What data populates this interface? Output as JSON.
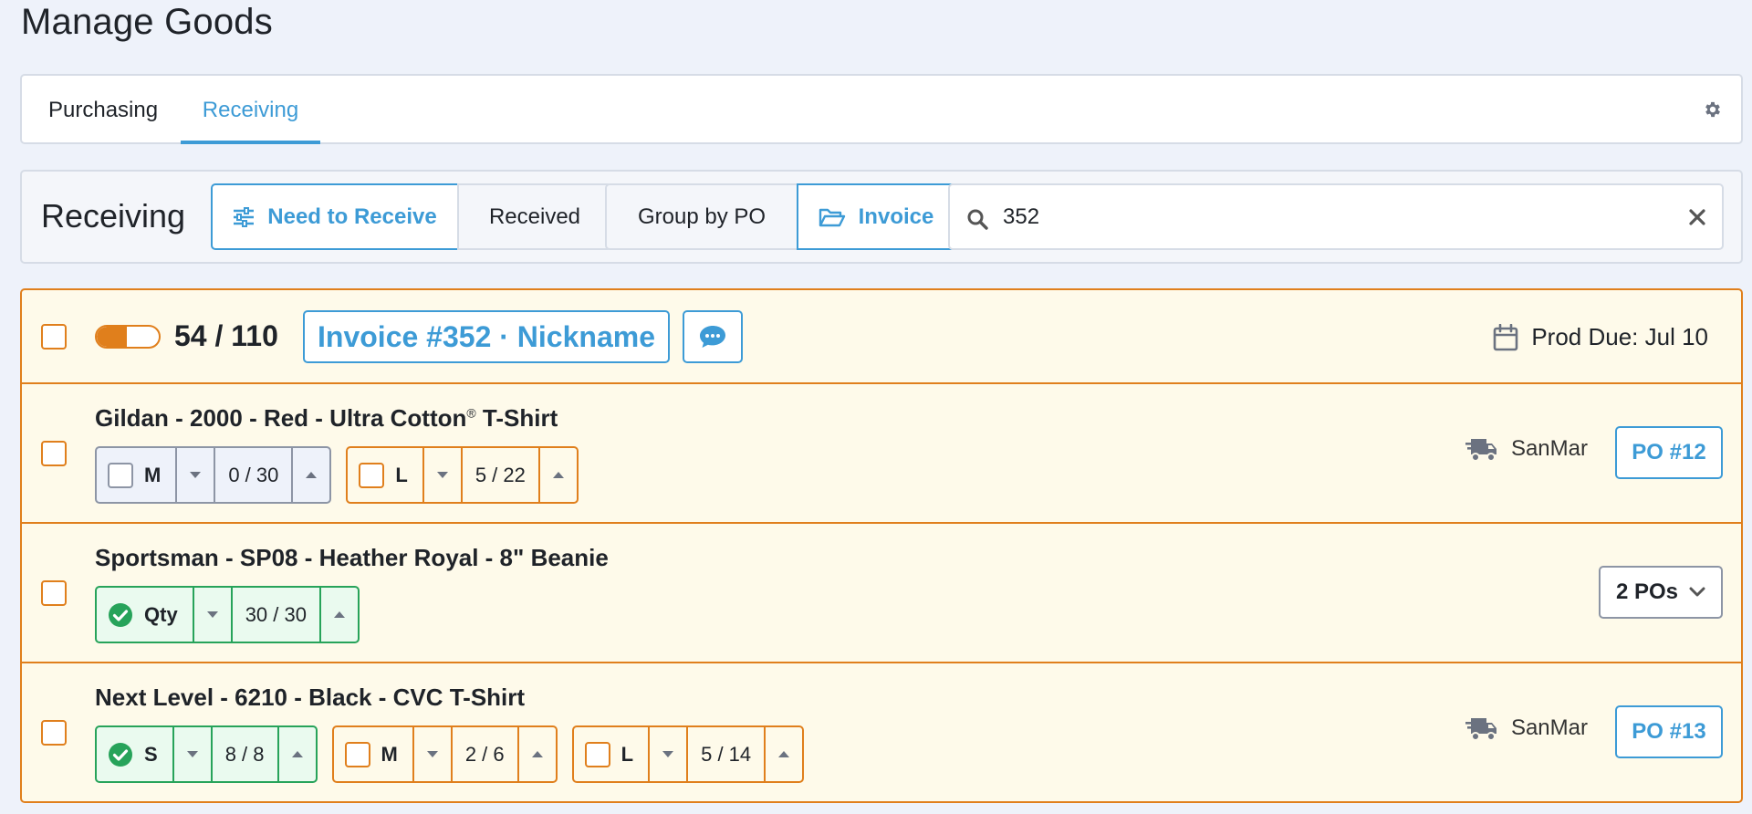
{
  "page": {
    "title": "Manage Goods"
  },
  "tabs": [
    {
      "label": "Purchasing",
      "active": false
    },
    {
      "label": "Receiving",
      "active": true
    }
  ],
  "toolbar": {
    "title": "Receiving",
    "filters": {
      "need_label": "Need to Receive",
      "received_label": "Received"
    },
    "grouping": {
      "group_po_label": "Group by PO",
      "invoice_label": "Invoice"
    },
    "search": {
      "value": "352"
    }
  },
  "invoice": {
    "received": 54,
    "total": 110,
    "progress_fraction": 0.49,
    "count_label": "54 / 110",
    "button_label": "Invoice #352 · Nickname",
    "due_label": "Prod Due: Jul 10"
  },
  "items": [
    {
      "title": "Gildan - 2000 - Red - Ultra Cotton",
      "title_mark": "®",
      "title_suffix": " T-Shirt",
      "sizes": [
        {
          "label": "M",
          "value": "0 / 30",
          "state": "grey"
        },
        {
          "label": "L",
          "value": "5 / 22",
          "state": "orange"
        }
      ],
      "vendor": "SanMar",
      "po_label": "PO #12"
    },
    {
      "title": "Sportsman - SP08 - Heather Royal - 8\" Beanie",
      "sizes": [
        {
          "label": "Qty",
          "value": "30 / 30",
          "state": "green"
        }
      ],
      "pos_label": "2 POs"
    },
    {
      "title": "Next Level - 6210 - Black - CVC T-Shirt",
      "sizes": [
        {
          "label": "S",
          "value": "8 / 8",
          "state": "green"
        },
        {
          "label": "M",
          "value": "2 / 6",
          "state": "orange"
        },
        {
          "label": "L",
          "value": "5 / 14",
          "state": "orange"
        }
      ],
      "vendor": "SanMar",
      "po_label": "PO #13"
    }
  ],
  "icons": {
    "gear": "gear-icon",
    "filter": "sliders-icon",
    "folder": "folder-open-icon",
    "search": "search-icon",
    "clear": "close-icon",
    "chat": "chat-bubble-icon",
    "calendar": "calendar-icon",
    "truck": "truck-icon",
    "check": "check-circle-icon",
    "chevron": "chevron-down-icon"
  },
  "colors": {
    "accent": "#3d9bd6",
    "warning": "#e07f1c",
    "success": "#27a35a",
    "panel_bg": "#fefaea",
    "page_bg": "#eef2fa"
  }
}
